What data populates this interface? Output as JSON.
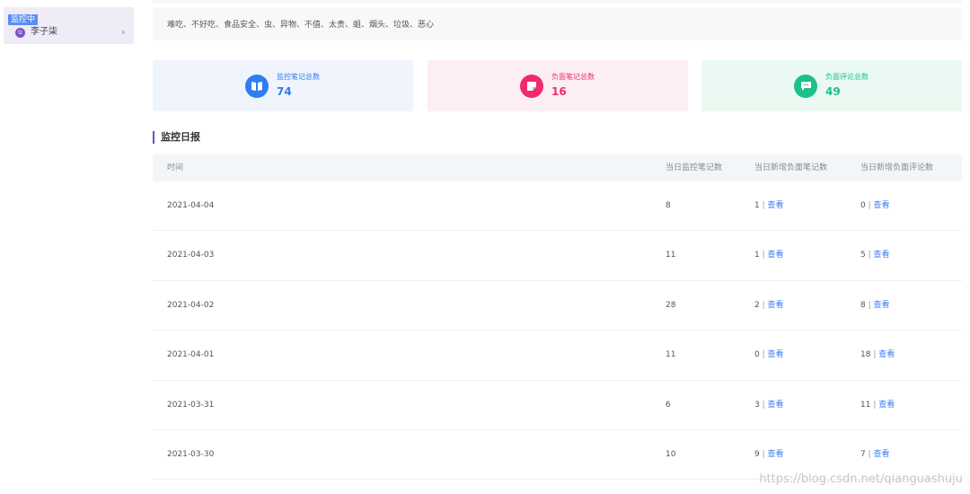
{
  "sidebar": {
    "badge": "监控中",
    "avatar_text": "lz",
    "name": "李子柒",
    "chevron": "›"
  },
  "keywords": "难吃、不好吃、食品安全、虫、异物、不值、太贵、蛆、烟头、垃圾、恶心",
  "stats": [
    {
      "label": "监控笔记总数",
      "value": "74",
      "icon": "book-icon",
      "color": "#2f7ef0"
    },
    {
      "label": "负面笔记总数",
      "value": "16",
      "icon": "note-icon",
      "color": "#ef2b6d"
    },
    {
      "label": "负面评论总数",
      "value": "49",
      "icon": "comment-icon",
      "color": "#1cc08a"
    }
  ],
  "section_title": "监控日报",
  "table": {
    "headers": [
      "时间",
      "当日监控笔记数",
      "当日新增负面笔记数",
      "当日新增负面评论数"
    ],
    "view_label": "查看",
    "rows": [
      {
        "date": "2021-04-04",
        "daily": "8",
        "neg_notes": "1",
        "neg_comments": "0"
      },
      {
        "date": "2021-04-03",
        "daily": "11",
        "neg_notes": "1",
        "neg_comments": "5"
      },
      {
        "date": "2021-04-02",
        "daily": "28",
        "neg_notes": "2",
        "neg_comments": "8"
      },
      {
        "date": "2021-04-01",
        "daily": "11",
        "neg_notes": "0",
        "neg_comments": "18"
      },
      {
        "date": "2021-03-31",
        "daily": "6",
        "neg_notes": "3",
        "neg_comments": "11"
      },
      {
        "date": "2021-03-30",
        "daily": "10",
        "neg_notes": "9",
        "neg_comments": "7"
      }
    ]
  },
  "watermark": "https://blog.csdn.net/qianguashuju"
}
